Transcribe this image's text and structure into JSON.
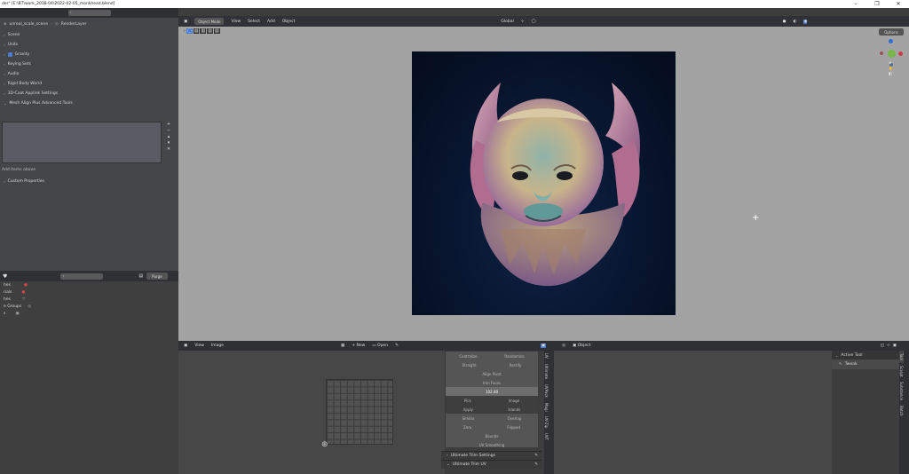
{
  "window": {
    "title": "der\" [E:\\BT\\work_2018-04\\2022-02-05_monkhead.blend]"
  },
  "outliner": {
    "scene_name": "unreal_scale_scene",
    "view_layer": "RenderLayer",
    "items": [
      "Scene",
      "Units",
      "Gravity",
      "Keying Sets",
      "Audio",
      "Rigid Body World",
      "3D-Coat Applink Settings",
      "Mesh Align Plus Advanced Tools"
    ],
    "add_items_hint": "Add items above",
    "custom_properties": "Custom Properties"
  },
  "data_panel": {
    "purge_label": "Purge",
    "rows": [
      "hes",
      "rials",
      "hes",
      "e Groups",
      "s"
    ]
  },
  "viewport": {
    "mode": "Object Mode",
    "menu": [
      "View",
      "Select",
      "Add",
      "Object"
    ],
    "orientation": "Global",
    "options_label": "Options"
  },
  "uv_editor": {
    "menu": [
      "View",
      "Image"
    ],
    "new_label": "New",
    "open_label": "Open",
    "object_label": "Object"
  },
  "uv_tool_panel": {
    "rows": [
      [
        "Centralize",
        "Randomize"
      ],
      [
        "Straight",
        "Rectify"
      ],
      [
        "Align Pivot"
      ],
      [
        "Iron Faces"
      ],
      [
        "102.40"
      ],
      [
        "Pick",
        "Image"
      ],
      [
        "Apply",
        "Islands"
      ],
      [
        "Similar",
        "Overlap"
      ],
      [
        "Zero",
        "Flipped"
      ],
      [
        "Bounds"
      ],
      [
        "UV Smoothing"
      ]
    ],
    "sub_panels": [
      "Ultimate Trim Settings",
      "Ultimate Trim UV"
    ],
    "side_tabs": [
      "UV",
      "Ultimate",
      "UVPack",
      "Magi",
      "UV-Zip",
      "UVT"
    ]
  },
  "right_panel": {
    "active_tool_label": "Active Tool",
    "tool_name": "Tweak",
    "side_tabs": [
      "Tool",
      "Sculpt",
      "Substance",
      "Batch"
    ]
  },
  "colors": {
    "viewport_bg": "#a3a3a3",
    "render_bg": "#07142c",
    "panel_bg": "#444649",
    "header_bg": "#2f3034"
  }
}
